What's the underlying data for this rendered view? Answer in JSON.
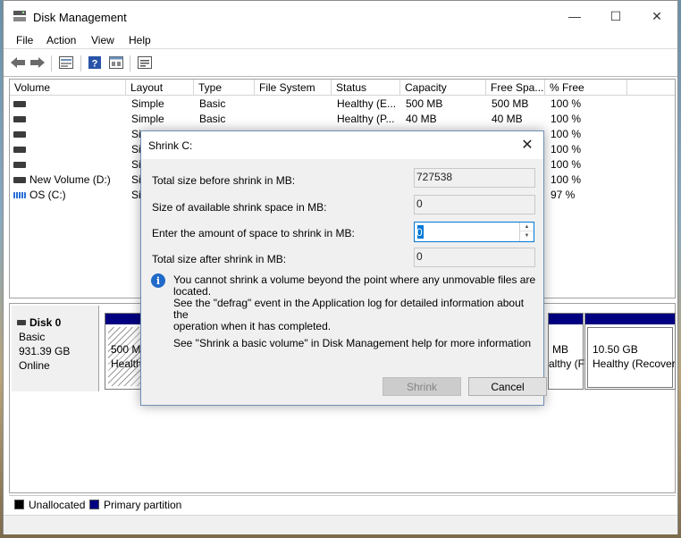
{
  "window": {
    "title": "Disk Management"
  },
  "menu": [
    "File",
    "Action",
    "View",
    "Help"
  ],
  "columns": [
    "Volume",
    "Layout",
    "Type",
    "File System",
    "Status",
    "Capacity",
    "Free Spa...",
    "% Free"
  ],
  "volumes": [
    {
      "name": "",
      "layout": "Simple",
      "type": "Basic",
      "fs": "",
      "status": "Healthy (E...",
      "capacity": "500 MB",
      "free": "500 MB",
      "pct": "100 %",
      "icon": "drive-icon"
    },
    {
      "name": "",
      "layout": "Simple",
      "type": "Basic",
      "fs": "",
      "status": "Healthy (P...",
      "capacity": "40 MB",
      "free": "40 MB",
      "pct": "100 %",
      "icon": "drive-icon"
    },
    {
      "name": "",
      "layout": "Si",
      "type": "",
      "fs": "",
      "status": "",
      "capacity": "",
      "free": "",
      "pct": "100 %",
      "icon": "drive-icon"
    },
    {
      "name": "",
      "layout": "Si",
      "type": "",
      "fs": "",
      "status": "",
      "capacity": "",
      "free": "",
      "pct": "100 %",
      "icon": "drive-icon"
    },
    {
      "name": "",
      "layout": "Si",
      "type": "",
      "fs": "",
      "status": "",
      "capacity": "",
      "free": "",
      "pct": "100 %",
      "icon": "drive-icon"
    },
    {
      "name": "New Volume (D:)",
      "layout": "Si",
      "type": "",
      "fs": "",
      "status": "",
      "capacity": "",
      "free": "",
      "pct": "100 %",
      "icon": "drive-icon"
    },
    {
      "name": "OS (C:)",
      "layout": "Si",
      "type": "",
      "fs": "",
      "status": "",
      "capacity": "",
      "free": "",
      "pct": "97 %",
      "icon": "os-drive-icon"
    }
  ],
  "disk": {
    "name": "Disk 0",
    "type": "Basic",
    "size": "931.39 GB",
    "state": "Online",
    "partitions": [
      {
        "line1": "500 MB",
        "line2": "Healthy"
      },
      {
        "line1": "MB",
        "line2": "althy (F"
      },
      {
        "line1": "10.50 GB",
        "line2": "Healthy (Recover"
      }
    ]
  },
  "legend": {
    "unallocated": "Unallocated",
    "primary": "Primary partition"
  },
  "colors": {
    "unallocated": "#000000",
    "primary": "#000080",
    "accent": "#0078d7"
  },
  "dialog": {
    "title": "Shrink C:",
    "total_before_label": "Total size before shrink in MB:",
    "total_before_value": "727538",
    "available_label": "Size of available shrink space in MB:",
    "available_value": "0",
    "amount_label": "Enter the amount of space to shrink in MB:",
    "amount_value": "0",
    "total_after_label": "Total size after shrink in MB:",
    "total_after_value": "0",
    "info_line1": "You cannot shrink a volume beyond the point where any unmovable files are located.",
    "info_line2": "See the \"defrag\" event in the Application log for detailed information about the",
    "info_line3": "operation when it has completed.",
    "help": "See \"Shrink a basic volume\" in Disk Management help for more information",
    "shrink_label": "Shrink",
    "cancel_label": "Cancel"
  }
}
